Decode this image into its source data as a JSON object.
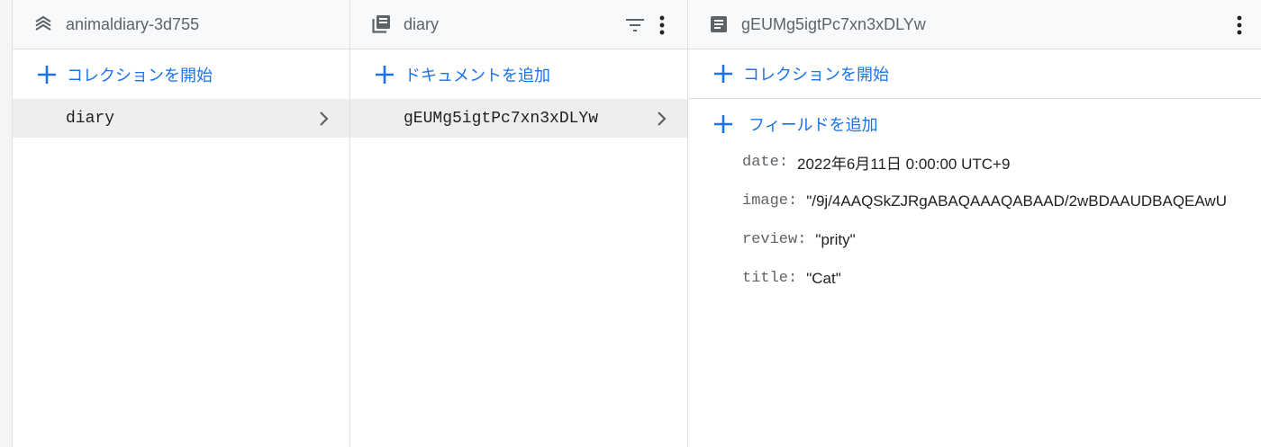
{
  "colors": {
    "accent": "#1a73e8",
    "header_bg": "#f8f9fa",
    "selected_bg": "#eeeeee",
    "muted_text": "#5f6368"
  },
  "root_panel": {
    "title": "animaldiary-3d755",
    "icon": "database-stack-icon",
    "start_collection_label": "コレクションを開始",
    "items": [
      {
        "label": "diary",
        "selected": true
      }
    ]
  },
  "collection_panel": {
    "title": "diary",
    "icon": "collection-icon",
    "add_document_label": "ドキュメントを追加",
    "items": [
      {
        "label": "gEUMg5igtPc7xn3xDLYw",
        "selected": true
      }
    ]
  },
  "document_panel": {
    "title": "gEUMg5igtPc7xn3xDLYw",
    "icon": "document-icon",
    "start_collection_label": "コレクションを開始",
    "add_field_label": "フィールドを追加",
    "fields": [
      {
        "key": "date",
        "value": "2022年6月11日 0:00:00 UTC+9"
      },
      {
        "key": "image",
        "value": "\"/9j/4AAQSkZJRgABAQAAAQABAAD/2wBDAAUDBAQEAwU"
      },
      {
        "key": "review",
        "value": "\"prity\""
      },
      {
        "key": "title",
        "value": "\"Cat\""
      }
    ]
  }
}
